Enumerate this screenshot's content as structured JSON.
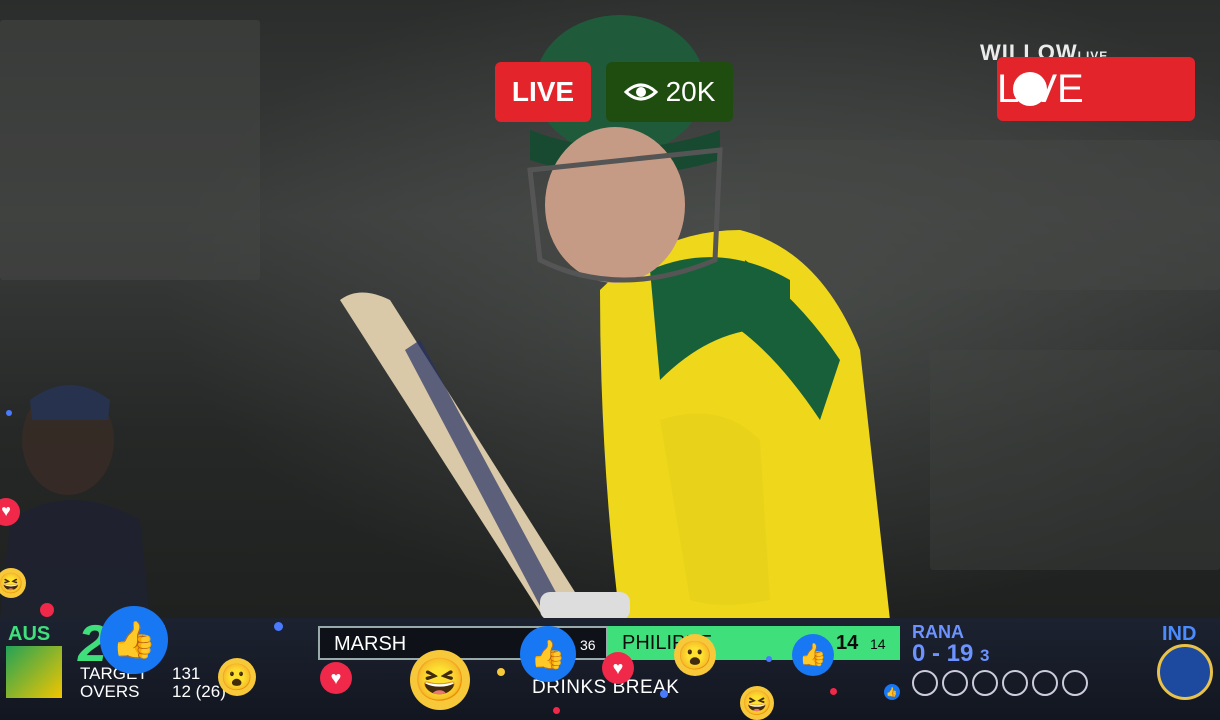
{
  "overlay": {
    "live_badge": "LIVE",
    "viewers": "20K",
    "broadcaster": "WILLOW",
    "broadcaster_sub": "LIVE",
    "live_right": "LIVE"
  },
  "scoreboard": {
    "team_left": "AUS",
    "score": "2​67",
    "target_label": "TARGET",
    "target_value": "131",
    "overs_label": "OVERS",
    "overs_value": "12 (26)",
    "batter1_name": "MARSH",
    "batter1_balls": "36",
    "batter2_name": "PHILIPPE",
    "batter2_runs": "14",
    "batter2_balls": "14",
    "bowler_name": "RANA",
    "bowler_figures": "0 - 19",
    "bowler_overs": "3",
    "status": "DRINKS BREAK",
    "team_right": "IND"
  },
  "colors": {
    "live_red": "#e3242b",
    "viewer_green": "#1f4d10",
    "aus_green": "#3fe07c",
    "ind_blue": "#6c93ff"
  },
  "reactions": [
    "like-icon",
    "love-icon",
    "haha-icon",
    "wow-icon"
  ]
}
